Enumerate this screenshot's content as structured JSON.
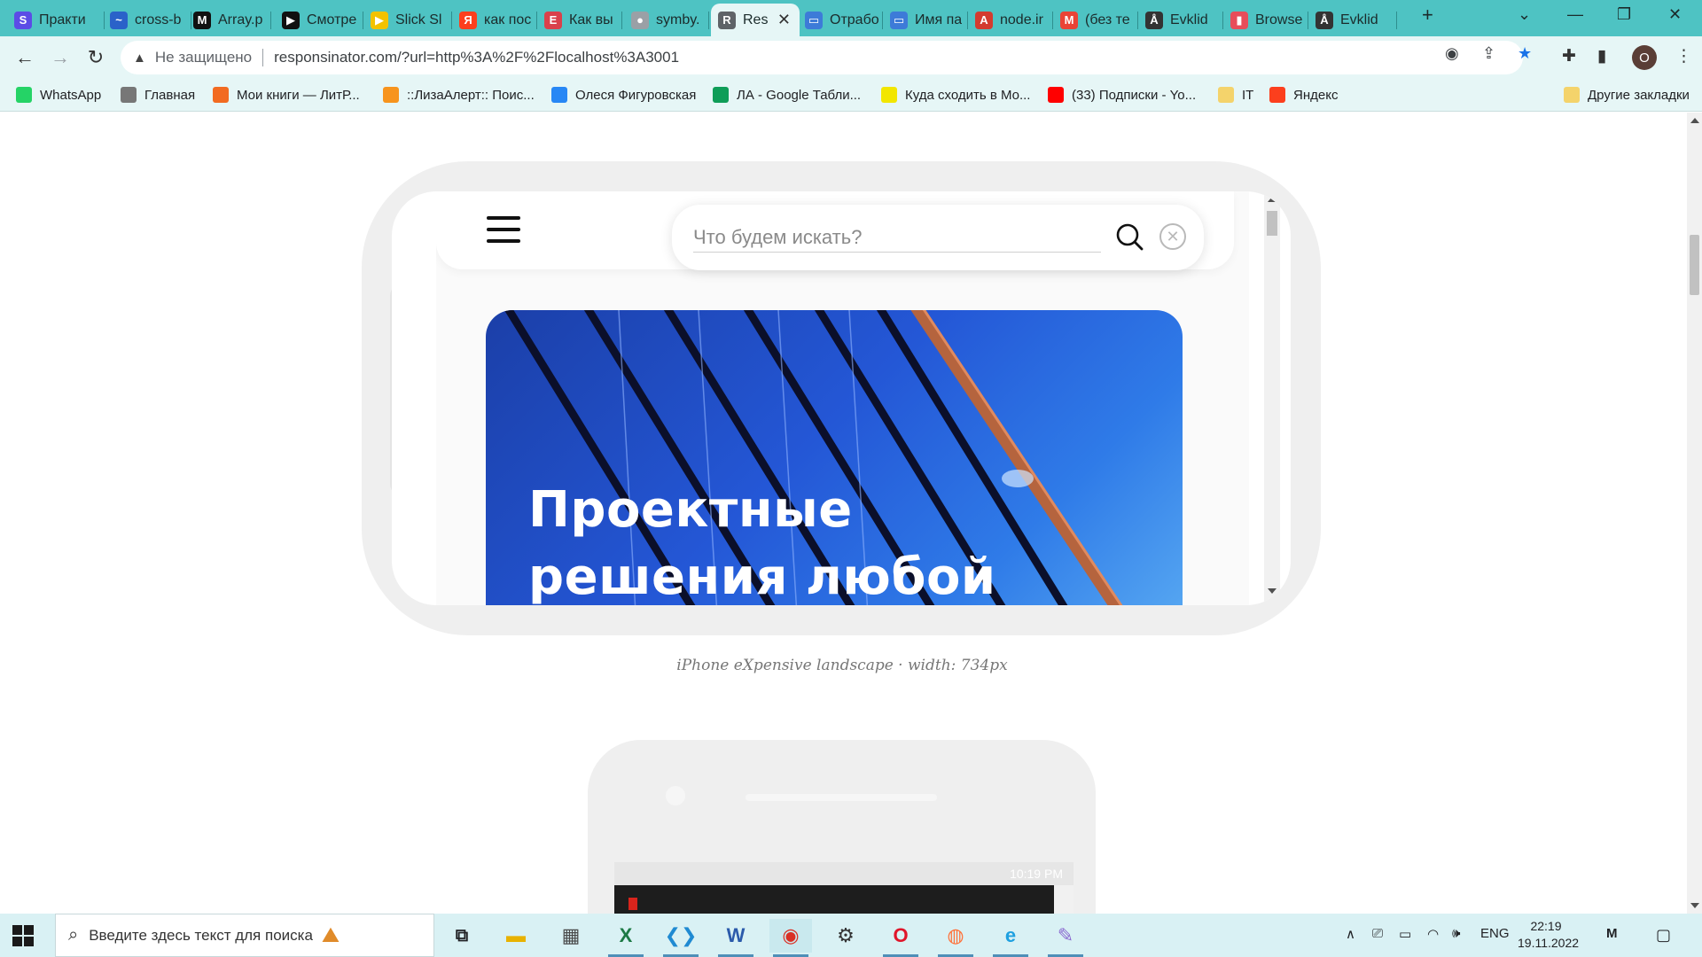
{
  "tabs": [
    {
      "label": "Практи",
      "icon": "S",
      "color": "#5c4ce6"
    },
    {
      "label": "cross-b",
      "icon": "~",
      "color": "#2a62c9"
    },
    {
      "label": "Array.p",
      "icon": "M",
      "color": "#111111"
    },
    {
      "label": "Смотре",
      "icon": "▶",
      "color": "#111111"
    },
    {
      "label": "Slick Sl",
      "icon": "▶",
      "color": "#f2c200"
    },
    {
      "label": "как пос",
      "icon": "Я",
      "color": "#fc3f1d"
    },
    {
      "label": "Как вы",
      "icon": "Е",
      "color": "#d9414b"
    },
    {
      "label": "symby.",
      "icon": "●",
      "color": "#9aa0a6"
    },
    {
      "label": "Res",
      "icon": "R",
      "color": "#5f6368",
      "active": true
    },
    {
      "label": "Отрабо",
      "icon": "▭",
      "color": "#3d7bd8"
    },
    {
      "label": "Имя па",
      "icon": "▭",
      "color": "#3d7bd8"
    },
    {
      "label": "node.ir",
      "icon": "A",
      "color": "#d33b2f"
    },
    {
      "label": "(без те",
      "icon": "M",
      "color": "#ea4335"
    },
    {
      "label": "Evklid",
      "icon": "Å",
      "color": "#333333"
    },
    {
      "label": "Browse",
      "icon": "▮",
      "color": "#e74d5a"
    },
    {
      "label": "Evklid",
      "icon": "Å",
      "color": "#333333"
    }
  ],
  "address": {
    "security_label": "Не защищено",
    "url": "responsinator.com/?url=http%3A%2F%2Flocalhost%3A3001"
  },
  "profile_initial": "О",
  "bookmarks": [
    {
      "label": "WhatsApp",
      "icon": "whatsapp-icon",
      "color": "#25d366"
    },
    {
      "label": "Главная",
      "icon": "bird-icon",
      "color": "#777777"
    },
    {
      "label": "Мои книги — ЛитР...",
      "icon": "litres-icon",
      "color": "#f26b21"
    },
    {
      "label": "::ЛизаАлерт:: Поис...",
      "icon": "lizaalert-icon",
      "color": "#f7941d"
    },
    {
      "label": "Олеся Фигуровская",
      "icon": "vk-icon",
      "color": "#2787f5"
    },
    {
      "label": "ЛА - Google Табли...",
      "icon": "sheets-icon",
      "color": "#0f9d58"
    },
    {
      "label": "Куда сходить в Мо...",
      "icon": "afisha-icon",
      "color": "#f2e600"
    },
    {
      "label": "(33) Подписки - Yo...",
      "icon": "youtube-icon",
      "color": "#ff0000"
    },
    {
      "label": "IT",
      "icon": "folder-icon",
      "color": "#f4d36b"
    },
    {
      "label": "Яндекс",
      "icon": "yandex-icon",
      "color": "#fc3f1d"
    }
  ],
  "other_bookmarks": "Другие закладки",
  "site": {
    "search_placeholder": "Что будем искать?",
    "hero_title_line1": "Проектные",
    "hero_title_line2": "решения любой"
  },
  "caption": "iPhone eXpensive landscape · width: 734px",
  "portrait_status_time": "10:19 PM",
  "taskbar": {
    "search_placeholder": "Введите здесь текст для поиска",
    "lang": "ENG",
    "time": "22:19",
    "date": "19.11.2022"
  }
}
